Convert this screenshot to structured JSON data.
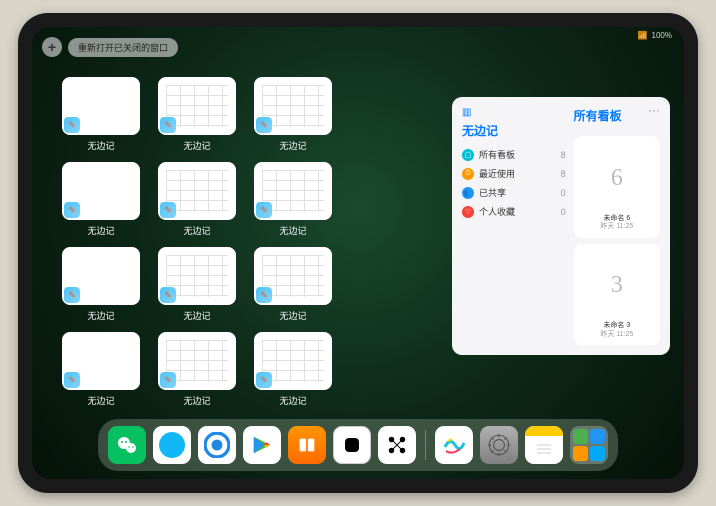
{
  "status": {
    "signal": "📶",
    "battery": "100%"
  },
  "topbar": {
    "plus": "+",
    "reopen_label": "重新打开已关闭的窗口"
  },
  "grid": {
    "app_label": "无边记",
    "items": [
      {
        "variant": "blank"
      },
      {
        "variant": "grid"
      },
      {
        "variant": "grid"
      },
      {
        "variant": "blank"
      },
      {
        "variant": "grid"
      },
      {
        "variant": "grid"
      },
      {
        "variant": "blank"
      },
      {
        "variant": "grid"
      },
      {
        "variant": "grid"
      },
      {
        "variant": "blank"
      },
      {
        "variant": "grid"
      },
      {
        "variant": "grid"
      }
    ]
  },
  "panel": {
    "left_title": "无边记",
    "right_title": "所有看板",
    "menu": "···",
    "sidebar": [
      {
        "icon": "cyan",
        "glyph": "▢",
        "label": "所有看板",
        "count": "8"
      },
      {
        "icon": "orange",
        "glyph": "⏱",
        "label": "最近使用",
        "count": "8"
      },
      {
        "icon": "blue",
        "glyph": "👥",
        "label": "已共享",
        "count": "0"
      },
      {
        "icon": "red",
        "glyph": "♡",
        "label": "个人收藏",
        "count": "0"
      }
    ],
    "boards": [
      {
        "sketch": "6",
        "name": "未命名 6",
        "time": "昨天 11:25"
      },
      {
        "sketch": "3",
        "name": "未命名 3",
        "time": "昨天 11:25"
      }
    ]
  },
  "dock": {
    "items": [
      {
        "name": "wechat",
        "label": "WeChat"
      },
      {
        "name": "qq",
        "label": "QQ"
      },
      {
        "name": "browser",
        "label": "Browser"
      },
      {
        "name": "gplay",
        "label": "Play"
      },
      {
        "name": "books",
        "label": "Books"
      },
      {
        "name": "blackbox",
        "label": "App"
      },
      {
        "name": "nodes",
        "label": "App"
      }
    ],
    "recent": [
      {
        "name": "freeform",
        "label": "Freeform"
      },
      {
        "name": "settings",
        "label": "Settings"
      },
      {
        "name": "notes",
        "label": "Notes"
      },
      {
        "name": "group",
        "label": "Folder"
      }
    ]
  }
}
